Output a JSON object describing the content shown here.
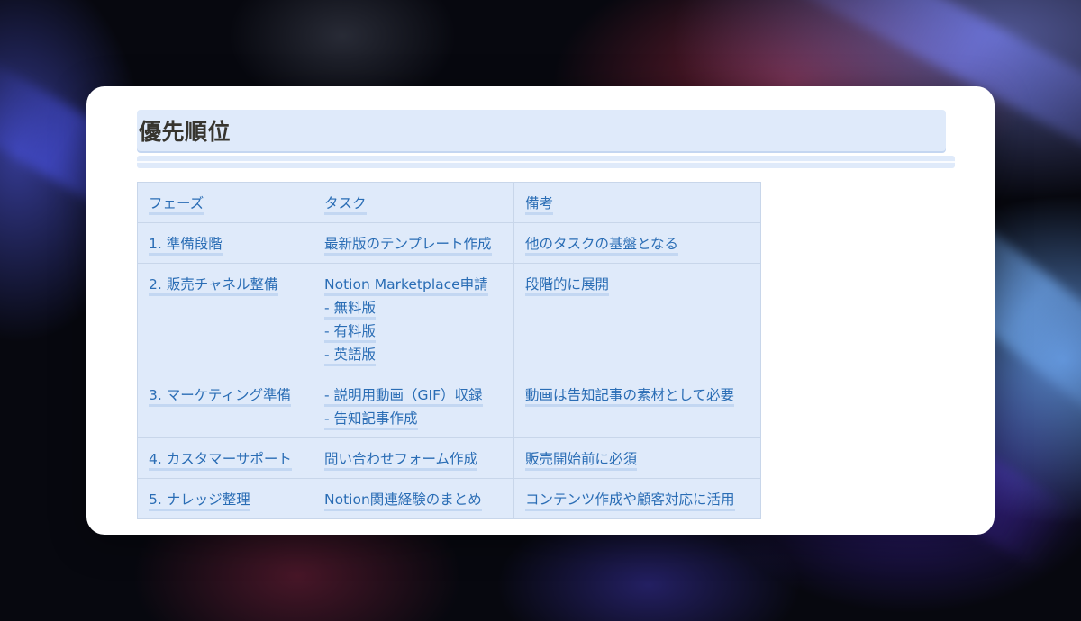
{
  "page": {
    "title": "優先順位"
  },
  "table": {
    "headers": [
      "フェーズ",
      "タスク",
      "備考"
    ],
    "rows": [
      {
        "phase": [
          "1. 準備段階"
        ],
        "task": [
          "最新版のテンプレート作成"
        ],
        "note": [
          "他のタスクの基盤となる"
        ]
      },
      {
        "phase": [
          "2. 販売チャネル整備"
        ],
        "task": [
          "Notion Marketplace申請",
          "- 無料版",
          "- 有料版",
          "- 英語版"
        ],
        "note": [
          "段階的に展開"
        ]
      },
      {
        "phase": [
          "3. マーケティング準備"
        ],
        "task": [
          "- 説明用動画（GIF）収録",
          "- 告知記事作成"
        ],
        "note": [
          "動画は告知記事の素材として必要"
        ]
      },
      {
        "phase": [
          "4. カスタマーサポート"
        ],
        "task": [
          "問い合わせフォーム作成"
        ],
        "note": [
          "販売開始前に必須"
        ]
      },
      {
        "phase": [
          "5. ナレッジ整理"
        ],
        "task": [
          "Notion関連経験のまとめ"
        ],
        "note": [
          "コンテンツ作成や顧客対応に活用"
        ]
      }
    ]
  },
  "colors": {
    "highlight": "#dfeafa",
    "text_blue": "#2a6db5",
    "title_text": "#37352f",
    "card": "#ffffff"
  }
}
